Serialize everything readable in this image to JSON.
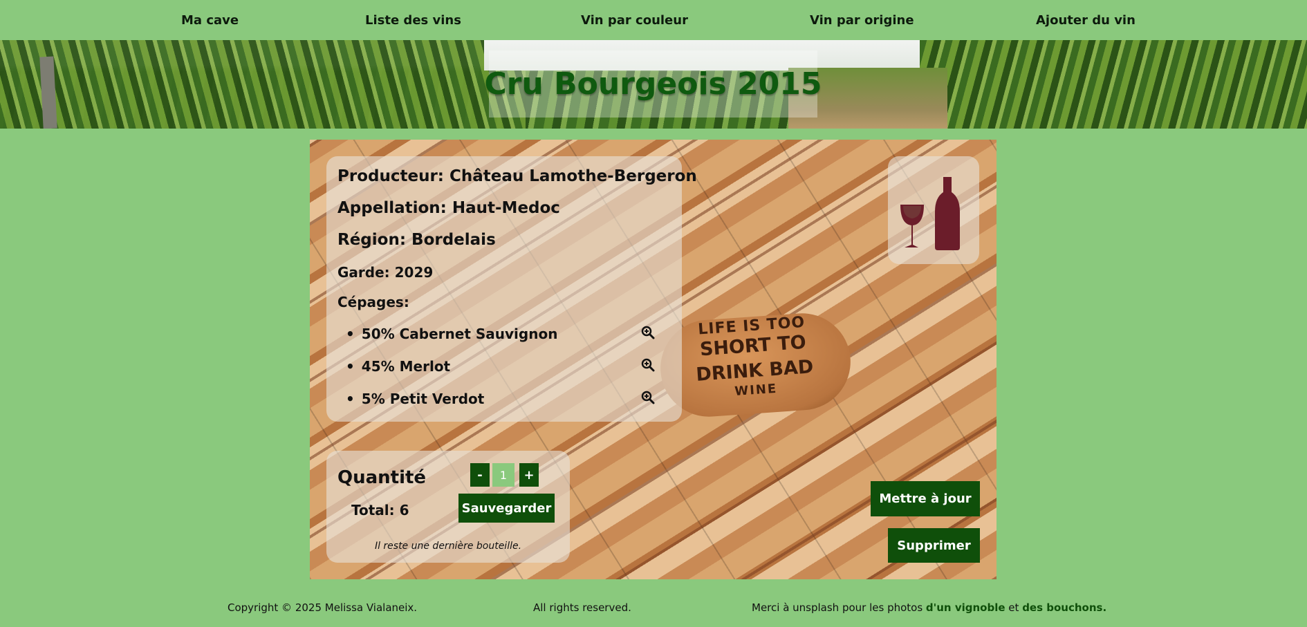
{
  "nav": {
    "items": [
      "Ma cave",
      "Liste des vins",
      "Vin par couleur",
      "Vin par origine",
      "Ajouter du vin"
    ]
  },
  "banner": {
    "title": "Cru Bourgeois 2015"
  },
  "wine": {
    "producteur": "Producteur: Château Lamothe-Bergeron",
    "appellation": "Appellation: Haut-Medoc",
    "region": "Région: Bordelais",
    "garde": "Garde: 2029",
    "cepages_label": "Cépages:",
    "cepages": [
      "50% Cabernet Sauvignon",
      "45% Merlot",
      "5% Petit Verdot"
    ],
    "icon_color": "#6b1d2a"
  },
  "background_cork_text": [
    "LIFE IS TOO",
    "SHORT TO",
    "DRINK BAD",
    "WINE"
  ],
  "quantity": {
    "label": "Quantité",
    "minus": "-",
    "value": "1",
    "plus": "+",
    "save": "Sauvegarder",
    "total": "Total: 6",
    "note": "Il reste une dernière bouteille."
  },
  "actions": {
    "update": "Mettre à jour",
    "delete": "Supprimer"
  },
  "footer": {
    "copyright": "Copyright © 2025 Melissa Vialaneix.",
    "rights": "All rights reserved.",
    "thanks_prefix": "Merci à unsplash pour les photos ",
    "link_vignoble": "d'un vignoble",
    "and": " et ",
    "link_bouchons": "des bouchons."
  },
  "colors": {
    "accent": "#0f4f0a",
    "background": "#8ac97d",
    "title": "#0f5a0f"
  }
}
